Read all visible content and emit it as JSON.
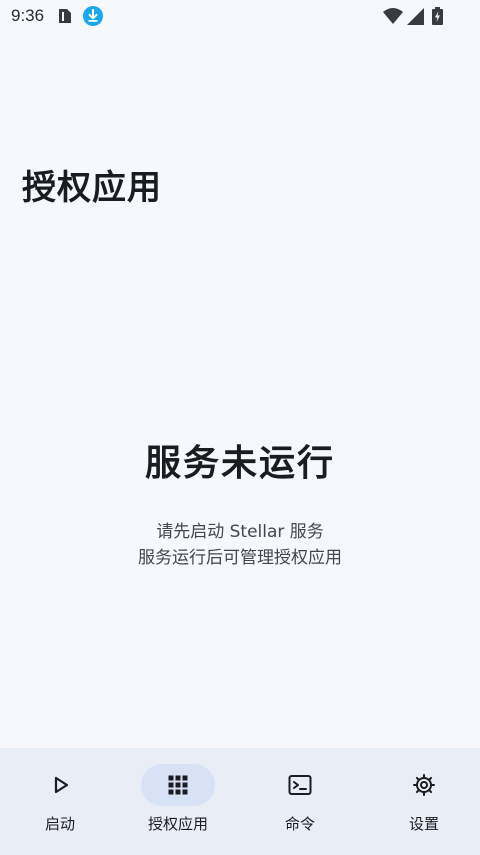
{
  "status_bar": {
    "time": "9:36",
    "icons": [
      "sim-card-icon",
      "download-icon",
      "wifi-icon",
      "signal-icon",
      "battery-charging-icon"
    ]
  },
  "header": {
    "title": "授权应用"
  },
  "empty_state": {
    "title": "服务未运行",
    "line1": "请先启动 Stellar 服务",
    "line2": "服务运行后可管理授权应用"
  },
  "bottom_nav": {
    "items": [
      {
        "label": "启动",
        "icon": "play-icon",
        "active": false
      },
      {
        "label": "授权应用",
        "icon": "apps-grid-icon",
        "active": true
      },
      {
        "label": "命令",
        "icon": "terminal-icon",
        "active": false
      },
      {
        "label": "设置",
        "icon": "gear-icon",
        "active": false
      }
    ]
  },
  "colors": {
    "background": "#f6f8fe",
    "nav_background": "#e9edf6",
    "active_indicator": "#d8e2f6",
    "download_badge": "#1aa8e8",
    "text_primary": "#1b1c20",
    "text_secondary": "#45464e"
  }
}
